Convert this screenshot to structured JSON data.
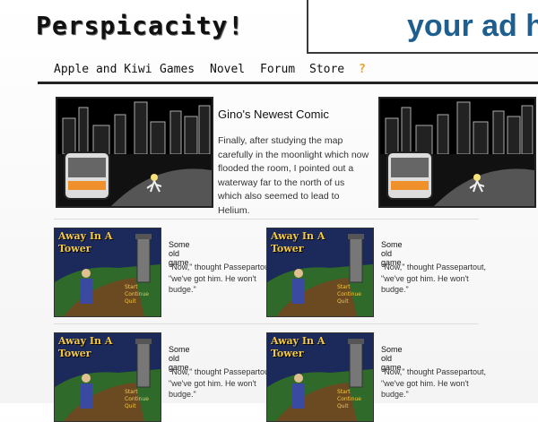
{
  "header": {
    "logo": "Perspicacity!",
    "ad_text": "your ad h"
  },
  "nav": {
    "items": [
      "Apple and Kiwi",
      "Games",
      "Novel",
      "Forum",
      "Store",
      "?"
    ]
  },
  "featured": {
    "title": "Gino's Newest Comic",
    "text": "Finally, after studying the map carefully in the moonlight which now flooded the room, I pointed out a waterway far to the north of us which also seemed to lead to Helium."
  },
  "games": [
    {
      "thumb_title": "Away In A\nTower",
      "menu": [
        "Start",
        "Continue",
        "Quit"
      ],
      "title": "Some old game",
      "desc": "\"Now,\" thought Passepartout, \"we've got him. He won't budge.\""
    },
    {
      "thumb_title": "Away In A\nTower",
      "menu": [
        "Start",
        "Continue",
        "Quit"
      ],
      "title": "Some old game",
      "desc": "\"Now,\" thought Passepartout, \"we've got him. He won't budge.\""
    },
    {
      "thumb_title": "Away In A\nTower",
      "menu": [
        "Start",
        "Continue",
        "Quit"
      ],
      "title": "Some old game",
      "desc": "\"Now,\" thought Passepartout, \"we've got him. He won't budge.\""
    },
    {
      "thumb_title": "Away In A\nTower",
      "menu": [
        "Start",
        "Continue",
        "Quit"
      ],
      "title": "Some old game",
      "desc": "\"Now,\" thought Passepartout, \"we've got him. He won't budge.\""
    }
  ],
  "colors": {
    "accent": "#f0a020",
    "ad_text": "#1f5f8f",
    "thumb_title": "#f5c842"
  }
}
